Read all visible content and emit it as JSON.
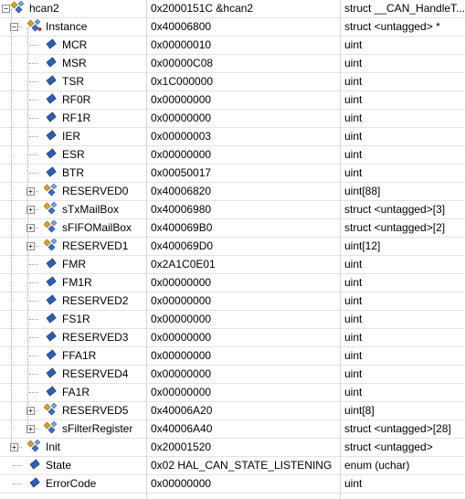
{
  "rows": [
    {
      "name": "hcan2",
      "value": "0x2000151C &hcan2",
      "type": "struct __CAN_HandleT...",
      "depth": 0,
      "icon": "struct-icon",
      "expander": "collapse"
    },
    {
      "name": "Instance",
      "value": "0x40006800",
      "type": "struct <untagged> *",
      "depth": 1,
      "icon": "struct-pointer-icon",
      "expander": "collapse"
    },
    {
      "name": "MCR",
      "value": "0x00000010",
      "type": "uint",
      "depth": 2,
      "icon": "field-icon",
      "expander": "none"
    },
    {
      "name": "MSR",
      "value": "0x00000C08",
      "type": "uint",
      "depth": 2,
      "icon": "field-icon",
      "expander": "none"
    },
    {
      "name": "TSR",
      "value": "0x1C000000",
      "type": "uint",
      "depth": 2,
      "icon": "field-icon",
      "expander": "none"
    },
    {
      "name": "RF0R",
      "value": "0x00000000",
      "type": "uint",
      "depth": 2,
      "icon": "field-icon",
      "expander": "none"
    },
    {
      "name": "RF1R",
      "value": "0x00000000",
      "type": "uint",
      "depth": 2,
      "icon": "field-icon",
      "expander": "none"
    },
    {
      "name": "IER",
      "value": "0x00000003",
      "type": "uint",
      "depth": 2,
      "icon": "field-icon",
      "expander": "none"
    },
    {
      "name": "ESR",
      "value": "0x00000000",
      "type": "uint",
      "depth": 2,
      "icon": "field-icon",
      "expander": "none"
    },
    {
      "name": "BTR",
      "value": "0x00050017",
      "type": "uint",
      "depth": 2,
      "icon": "field-icon",
      "expander": "none"
    },
    {
      "name": "RESERVED0",
      "value": "0x40006820",
      "type": "uint[88]",
      "depth": 2,
      "icon": "struct-icon",
      "expander": "expand"
    },
    {
      "name": "sTxMailBox",
      "value": "0x40006980",
      "type": "struct <untagged>[3]",
      "depth": 2,
      "icon": "struct-icon",
      "expander": "expand"
    },
    {
      "name": "sFIFOMailBox",
      "value": "0x400069B0",
      "type": "struct <untagged>[2]",
      "depth": 2,
      "icon": "struct-icon",
      "expander": "expand"
    },
    {
      "name": "RESERVED1",
      "value": "0x400069D0",
      "type": "uint[12]",
      "depth": 2,
      "icon": "struct-icon",
      "expander": "expand"
    },
    {
      "name": "FMR",
      "value": "0x2A1C0E01",
      "type": "uint",
      "depth": 2,
      "icon": "field-icon",
      "expander": "none"
    },
    {
      "name": "FM1R",
      "value": "0x00000000",
      "type": "uint",
      "depth": 2,
      "icon": "field-icon",
      "expander": "none"
    },
    {
      "name": "RESERVED2",
      "value": "0x00000000",
      "type": "uint",
      "depth": 2,
      "icon": "field-icon",
      "expander": "none"
    },
    {
      "name": "FS1R",
      "value": "0x00000000",
      "type": "uint",
      "depth": 2,
      "icon": "field-icon",
      "expander": "none"
    },
    {
      "name": "RESERVED3",
      "value": "0x00000000",
      "type": "uint",
      "depth": 2,
      "icon": "field-icon",
      "expander": "none"
    },
    {
      "name": "FFA1R",
      "value": "0x00000000",
      "type": "uint",
      "depth": 2,
      "icon": "field-icon",
      "expander": "none"
    },
    {
      "name": "RESERVED4",
      "value": "0x00000000",
      "type": "uint",
      "depth": 2,
      "icon": "field-icon",
      "expander": "none"
    },
    {
      "name": "FA1R",
      "value": "0x00000000",
      "type": "uint",
      "depth": 2,
      "icon": "field-icon",
      "expander": "none"
    },
    {
      "name": "RESERVED5",
      "value": "0x40006A20",
      "type": "uint[8]",
      "depth": 2,
      "icon": "struct-icon",
      "expander": "expand"
    },
    {
      "name": "sFilterRegister",
      "value": "0x40006A40",
      "type": "struct <untagged>[28]",
      "depth": 2,
      "icon": "struct-icon",
      "expander": "expand"
    },
    {
      "name": "Init",
      "value": "0x20001520",
      "type": "struct <untagged>",
      "depth": 1,
      "icon": "struct-icon",
      "expander": "expand"
    },
    {
      "name": "State",
      "value": "0x02 HAL_CAN_STATE_LISTENING",
      "type": "enum (uchar)",
      "depth": 1,
      "icon": "field-icon",
      "expander": "none"
    },
    {
      "name": "ErrorCode",
      "value": "0x00000000",
      "type": "uint",
      "depth": 1,
      "icon": "field-icon",
      "expander": "none"
    }
  ],
  "colors": {
    "row_border": "#e3e3e3",
    "column_separator": "#d6d6d6",
    "field_icon": "#2b5fb4",
    "struct_icon_blue": "#3a6fd1",
    "struct_icon_gold": "#d9a320"
  }
}
